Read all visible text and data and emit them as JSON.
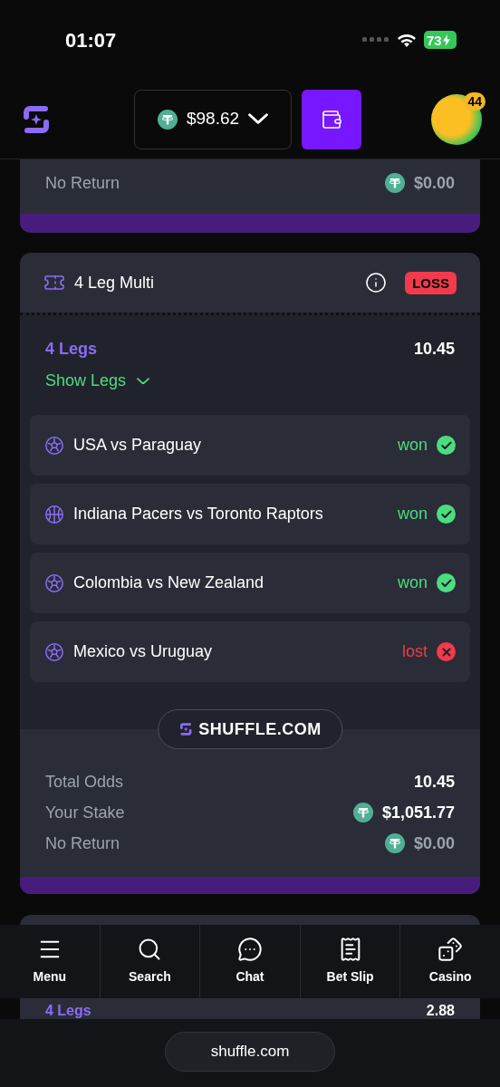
{
  "status_bar": {
    "time": "01:07",
    "battery": "73"
  },
  "header": {
    "balance": "$98.62",
    "avatar_badge": "44"
  },
  "previous_bet": {
    "return_label": "No Return",
    "return_amount": "$0.00"
  },
  "bet": {
    "title": "4 Leg Multi",
    "badge": "LOSS",
    "lost": true,
    "legs_label": "4 Legs",
    "odds": "10.45",
    "toggle": "Show Legs",
    "expanded": false,
    "legs": [
      {
        "kind": "soccer",
        "match": "USA vs Paraguay",
        "result": "won",
        "won": true
      },
      {
        "kind": "basketball",
        "match": "Indiana Pacers vs Toronto Raptors",
        "result": "won",
        "won": true
      },
      {
        "kind": "soccer",
        "match": "Colombia vs New Zealand",
        "result": "won",
        "won": true
      },
      {
        "kind": "soccer",
        "match": "Mexico vs Uruguay",
        "result": "lost",
        "won": false
      }
    ],
    "brand": "SHUFFLE.COM",
    "summary": [
      {
        "kind": "odds",
        "label": "Total Odds",
        "value": "10.45"
      },
      {
        "kind": "stake",
        "label": "Your Stake",
        "value": "$1,051.77"
      },
      {
        "kind": "return",
        "label": "No Return",
        "value": "$0.00"
      }
    ]
  },
  "next_bet": {
    "legs_label": "4 Legs",
    "odds": "2.88"
  },
  "nav": [
    {
      "label": "Menu"
    },
    {
      "label": "Search"
    },
    {
      "label": "Chat"
    },
    {
      "label": "Bet Slip"
    },
    {
      "label": "Casino"
    }
  ],
  "browser": {
    "url": "shuffle.com"
  }
}
